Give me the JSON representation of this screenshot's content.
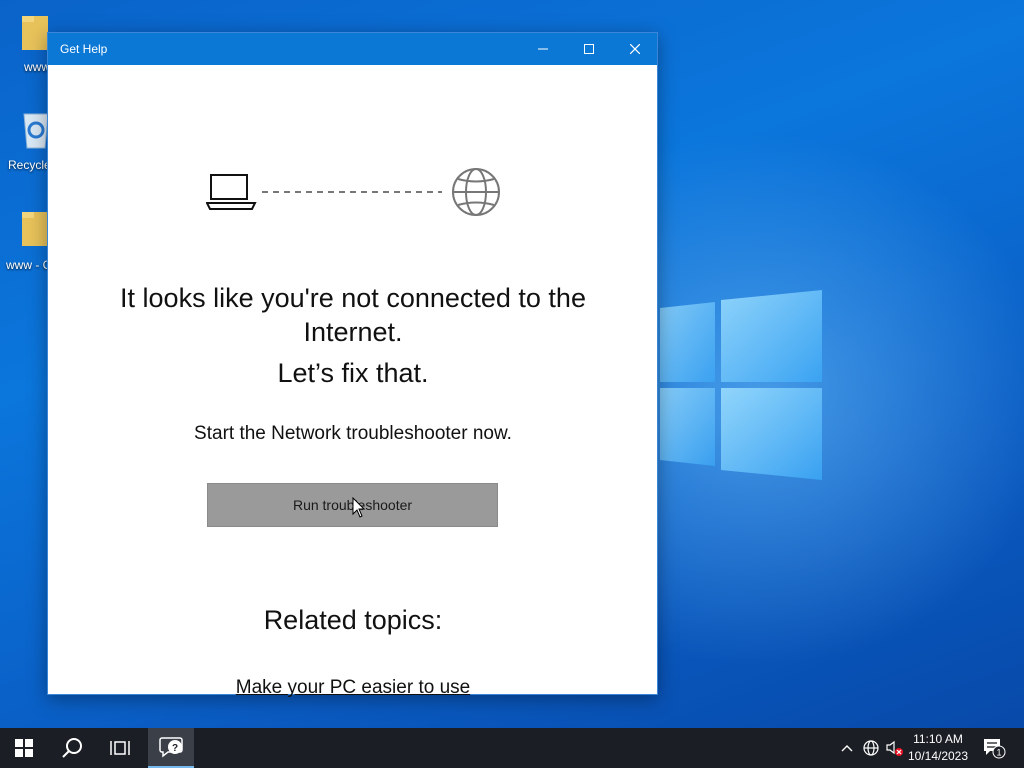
{
  "desktop": {
    "icons": [
      {
        "label": "www",
        "icon": "folder-icon"
      },
      {
        "label": "Recycle",
        "icon": "recycle-bin-icon"
      },
      {
        "label": "www - C",
        "icon": "folder-icon"
      }
    ]
  },
  "window": {
    "title": "Get Help",
    "controls": {
      "minimize": "minimize-icon",
      "maximize": "maximize-icon",
      "close": "close-icon"
    }
  },
  "main": {
    "illustration": {
      "left": "laptop-icon",
      "right": "globe-icon"
    },
    "headline": "It looks like you're not connected to the Internet.",
    "subhead": "Let’s fix that.",
    "description": "Start the Network troubleshooter now.",
    "run_button_label": "Run troubleshooter",
    "related_heading": "Related topics:",
    "related_link": "Make your PC easier to use"
  },
  "taskbar": {
    "items": [
      "windows-start-icon",
      "search-icon",
      "task-view-icon",
      "get-help-icon"
    ],
    "tray": {
      "icons": [
        "chevron-up-icon",
        "network-globe-icon",
        "volume-muted-icon"
      ],
      "time": "11:10 AM",
      "date": "10/14/2023",
      "notifications_count": "1"
    }
  },
  "colors": {
    "titlebar": "#0b78d6",
    "button_bg": "#9a9a9a",
    "taskbar": "#1b1e24",
    "desktop": "#0a63c9"
  }
}
